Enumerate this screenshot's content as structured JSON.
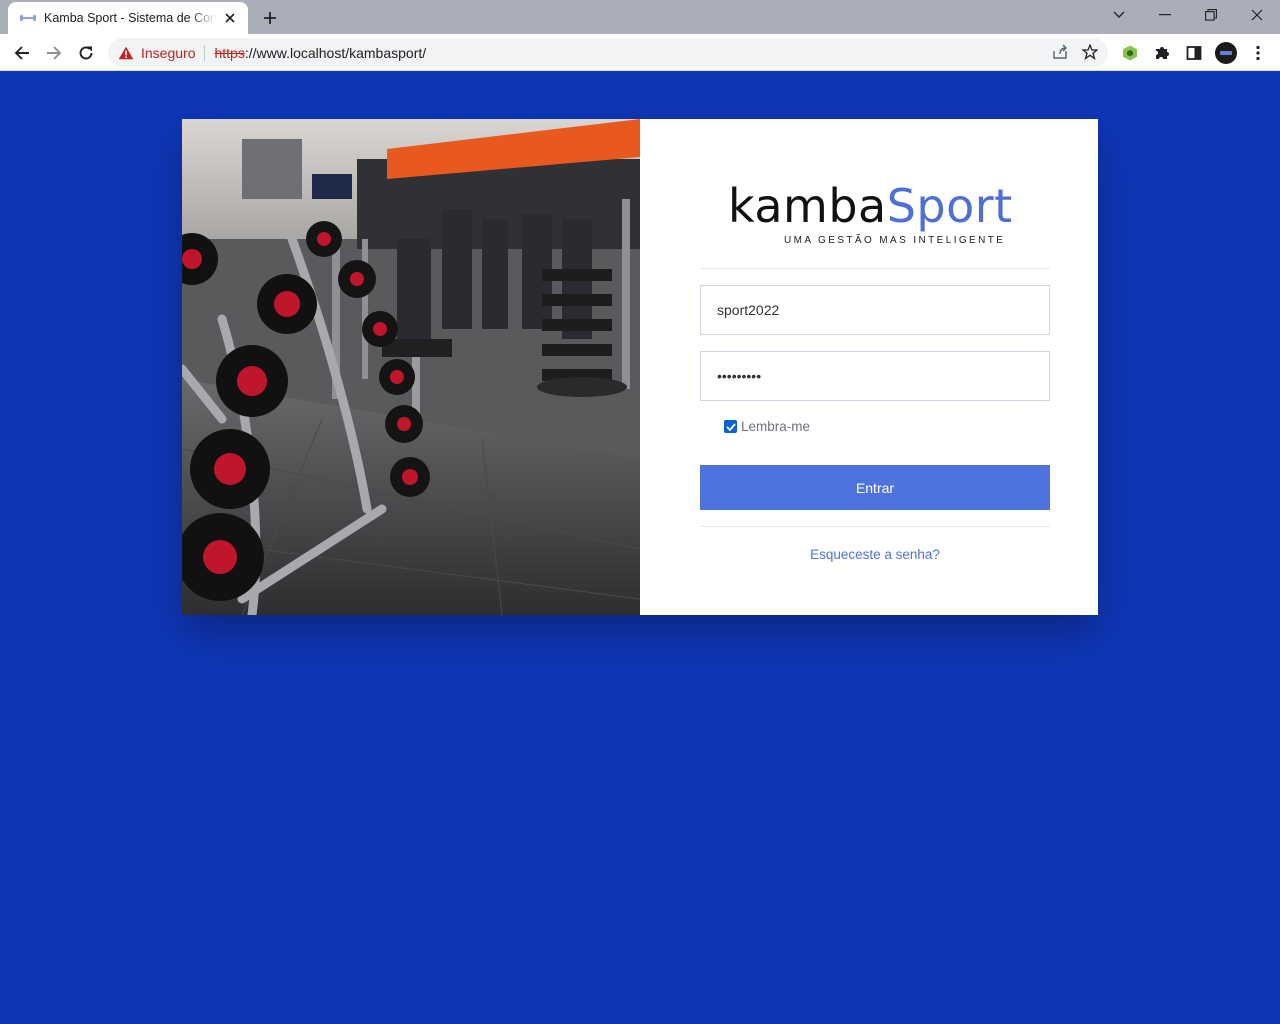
{
  "browser": {
    "tab_title": "Kamba Sport - Sistema de Controle",
    "security_label": "Inseguro",
    "url_protocol": "https",
    "url_rest": "://www.localhost/kambasport/"
  },
  "login": {
    "logo_kamba": "kamba",
    "logo_sport": "Sport",
    "tagline": "UMA GESTÃO MAS INTELIGENTE",
    "username_value": "sport2022",
    "password_value": "•••••••••",
    "remember_label": "Lembra-me",
    "remember_checked": true,
    "submit_label": "Entrar",
    "forgot_label": "Esqueceste a senha?"
  },
  "colors": {
    "page_background": "#0f36b6",
    "primary": "#4e73df",
    "insecure_red": "#c5221f"
  }
}
